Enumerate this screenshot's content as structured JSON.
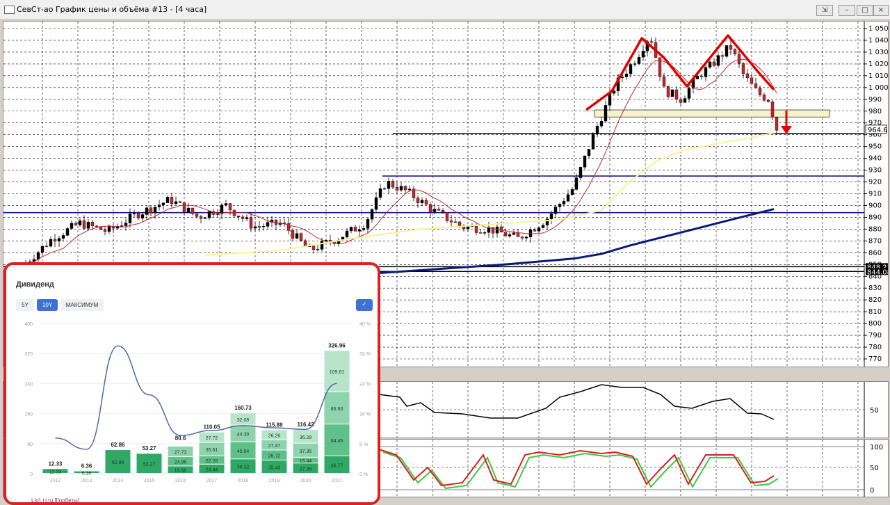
{
  "window": {
    "title": "СевСт-ао График цены и объёма #13 - [4 часа]",
    "buttons": [
      "restore-icon",
      "minimize-icon",
      "maximize-icon",
      "close-icon"
    ]
  },
  "price_chart": {
    "y_ticks": [
      "1 050",
      "1 040",
      "1 030",
      "1 020",
      "1 010",
      "1 000",
      "990",
      "980",
      "970",
      "960",
      "950",
      "940",
      "930",
      "920",
      "910",
      "900",
      "890",
      "880",
      "870",
      "860",
      "850",
      "840",
      "830",
      "820",
      "810",
      "800",
      "790",
      "780",
      "770"
    ],
    "current_price": "964.6",
    "level_labels": [
      "848.23",
      "844.08"
    ],
    "indicator_tag": "ge]",
    "colors": {
      "up": "#000000",
      "down": "#c0282c",
      "ma_short": "#c0282c",
      "ma_mid": "#f7f39a",
      "ma_long": "#0a1a7a",
      "levels": "#1a1a8a",
      "annotation": "#e00000"
    }
  },
  "oscillator1": {
    "y_ticks": [
      "50"
    ]
  },
  "oscillator2": {
    "y_ticks": [
      "100",
      "50",
      "0"
    ],
    "colors": {
      "k": "#d42020",
      "d": "#3ec83e"
    }
  },
  "dividend": {
    "title": "Дивиденд",
    "tabs": [
      "5Y",
      "10Y",
      "МАКСИМУМ"
    ],
    "active_tab": "10Y",
    "credit": "Lio) тт.ru [l[орбеты]",
    "chart_data": {
      "type": "bar",
      "categories": [
        "2012",
        "2013",
        "2014",
        "2015",
        "2016",
        "2017",
        "2018",
        "2019",
        "2020",
        "2021"
      ],
      "totals": [
        12.33,
        6.36,
        62.86,
        53.27,
        80.6,
        110.05,
        160.73,
        115.88,
        116.42,
        326.96
      ],
      "segments": [
        [
          12.33
        ],
        [
          6.36
        ],
        [
          62.86
        ],
        [
          53.27
        ],
        [
          19.66,
          24.96,
          27.73
        ],
        [
          24.44,
          22.28,
          35.61,
          27.72
        ],
        [
          38.32,
          45.94,
          44.39,
          32.08
        ],
        [
          35.43,
          26.72,
          27.47,
          26.26
        ],
        [
          27.35,
          15.44,
          37.35,
          36.28
        ],
        [
          46.77,
          84.45,
          85.93,
          109.81
        ]
      ],
      "yield_pct": [
        9.5,
        6.5,
        34,
        21,
        10.2,
        11.5,
        12.8,
        12.2,
        11.8,
        24
      ],
      "y_left_ticks": [
        "0",
        "80",
        "160",
        "240",
        "320",
        "400"
      ],
      "y_right_ticks": [
        "0 %",
        "8 %",
        "16 %",
        "24 %",
        "32 %",
        "40 %"
      ],
      "ylim": [
        0,
        400
      ],
      "y2lim": [
        0,
        40
      ],
      "colors": {
        "bar_dark": "#2fa866",
        "bar_mid": "#5fc08a",
        "bar_light": "#8fd3ae",
        "bar_lightest": "#b8e4cc",
        "line": "#5566a8"
      }
    }
  }
}
